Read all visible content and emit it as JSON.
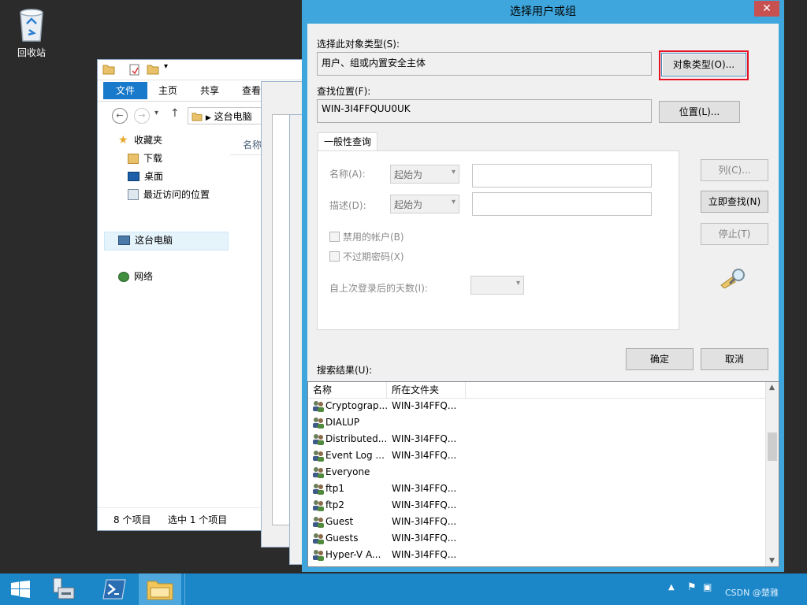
{
  "desktop": {
    "recycle_bin_label": "回收站"
  },
  "explorer": {
    "ribbon_tabs": [
      "文件",
      "主页",
      "共享",
      "查看"
    ],
    "address_text": "这台电脑",
    "column_name": "名称",
    "nav": {
      "favorites": "收藏夹",
      "downloads": "下载",
      "desktop": "桌面",
      "recent": "最近访问的位置",
      "this_pc": "这台电脑",
      "network": "网络"
    },
    "status_count": "8 个项目",
    "status_selected": "选中 1 个项目"
  },
  "dialog": {
    "title": "选择用户或组",
    "close_glyph": "✕",
    "object_type_label": "选择此对象类型(S):",
    "object_type_value": "用户、组或内置安全主体",
    "object_type_button": "对象类型(O)...",
    "location_label": "查找位置(F):",
    "location_value": "WIN-3I4FFQUU0UK",
    "location_button": "位置(L)...",
    "tab_label": "一般性查询",
    "name_label": "名称(A):",
    "name_combo": "起始为",
    "desc_label": "描述(D):",
    "desc_combo": "起始为",
    "disabled_accounts": "禁用的帐户(B)",
    "no_expire_pw": "不过期密码(X)",
    "days_since_login": "自上次登录后的天数(I):",
    "columns_button": "列(C)...",
    "find_now_button": "立即查找(N)",
    "stop_button": "停止(T)",
    "ok_button": "确定",
    "cancel_button": "取消",
    "results_label": "搜索结果(U):",
    "results_columns": [
      "名称",
      "所在文件夹"
    ],
    "results": [
      {
        "name": "Cryptograp...",
        "folder": "WIN-3I4FFQ..."
      },
      {
        "name": "DIALUP",
        "folder": ""
      },
      {
        "name": "Distributed...",
        "folder": "WIN-3I4FFQ..."
      },
      {
        "name": "Event Log ...",
        "folder": "WIN-3I4FFQ..."
      },
      {
        "name": "Everyone",
        "folder": ""
      },
      {
        "name": "ftp1",
        "folder": "WIN-3I4FFQ..."
      },
      {
        "name": "ftp2",
        "folder": "WIN-3I4FFQ..."
      },
      {
        "name": "Guest",
        "folder": "WIN-3I4FFQ..."
      },
      {
        "name": "Guests",
        "folder": "WIN-3I4FFQ..."
      },
      {
        "name": "Hyper-V A...",
        "folder": "WIN-3I4FFQ..."
      }
    ]
  },
  "taskbar": {
    "watermark": "CSDN @楚雅"
  }
}
